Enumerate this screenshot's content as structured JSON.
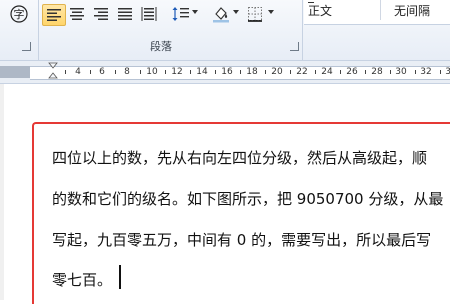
{
  "ribbon": {
    "section_label": "段落",
    "styles": [
      "正文",
      "无间隔"
    ]
  },
  "ruler": {
    "labels": [
      "4",
      "6",
      "8",
      "10",
      "12",
      "14",
      "16",
      "18",
      "20",
      "22",
      "24",
      "26",
      "28",
      "30",
      "32",
      "34",
      "36"
    ]
  },
  "document": {
    "lines": [
      "四位以上的数，先从右向左四位分级，然后从高级起，顺",
      "的数和它们的级名。如下图所示，把 9050700 分级，从最",
      "写起，九百零五万，中间有 0 的，需要写出，所以最后写",
      "零七百。"
    ]
  }
}
